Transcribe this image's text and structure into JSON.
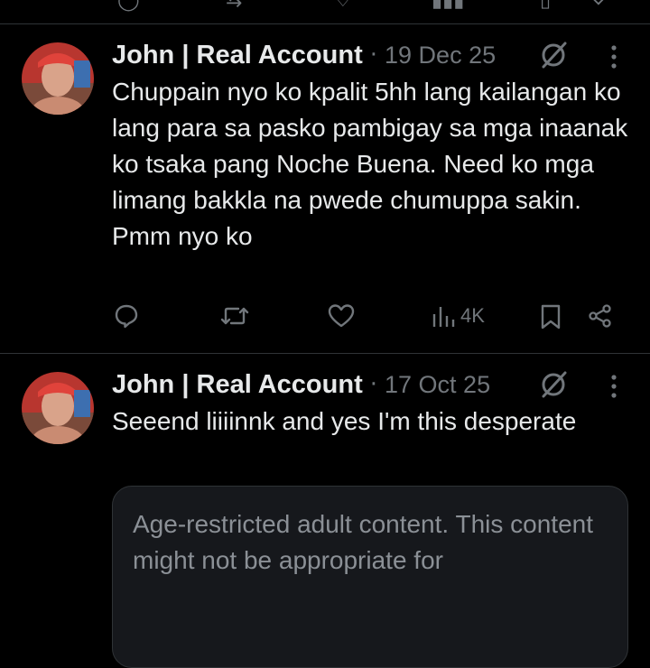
{
  "posts": [
    {
      "author": "John | Real Account",
      "separator": "·",
      "date": "19 Dec 25",
      "text": "Chuppain nyo ko kpalit 5hh lang kailangan ko lang para sa pasko pambigay sa mga inaanak ko tsaka pang Noche Buena. Need ko mga limang bakkla na pwede chumuppa sakin. Pmm nyo ko",
      "views": "4K"
    },
    {
      "author": "John | Real Account",
      "separator": "·",
      "date": "17 Oct 25",
      "text": "Seeend liiiinnk and yes I'm this desperate",
      "warning": "Age-restricted adult content. This content might not be appropriate for"
    }
  ],
  "icons": {
    "reply": "reply-icon",
    "repost": "repost-icon",
    "like": "heart-icon",
    "views": "views-icon",
    "bookmark": "bookmark-icon",
    "share": "share-icon",
    "grok": "grok-icon",
    "more": "more-icon"
  },
  "colors": {
    "background": "#000000",
    "text": "#e7e9ea",
    "muted": "#71767b",
    "divider": "#2f3336"
  }
}
